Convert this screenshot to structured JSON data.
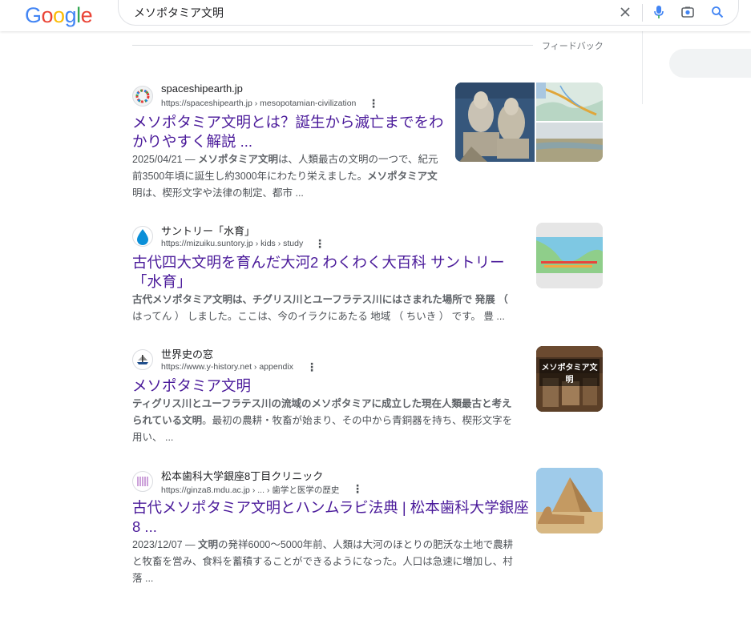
{
  "header": {
    "logo": "Google",
    "query": "メソポタミア文明"
  },
  "feedback_label": "フィードバック",
  "results": [
    {
      "site_name": "spaceshipearth.jp",
      "url": "https://spaceshipearth.jp",
      "path": " › mesopotamian-civilization",
      "title_line1": "メソポタミア文明とは？誕生から滅亡までをわ",
      "title_line2": "かりやすく解説 ...",
      "date": "2025/04/21 —",
      "snippet_line1_b": "メソポタミア文明",
      "snippet_line1_rest": "は、人類最古の文明の一つで、紀元",
      "snippet_line2_a": "前3500年頃に誕生し約3000年にわたり栄えました。",
      "snippet_line2_b": "メソポタミア文",
      "snippet_line3_b": "明",
      "snippet_line3_rest": "は、楔形文字や法律の制定、都市 ..."
    },
    {
      "site_name": "サントリー「水育」",
      "url": "https://mizuiku.suntory.jp",
      "path": " › kids › study",
      "title_line1": "古代四大文明を育んだ大河2 わくわく大百科 サントリー",
      "title_line2": "「水育」",
      "snippet_line1_b": "古代メソポタミア文明は、チグリス川とユーフラテス川にはさまれた場所で 発展 （",
      "snippet_line2": "はってん ） しました。ここは、今のイラクにあたる 地域 （ ちいき ） です。 豊 ..."
    },
    {
      "site_name": "世界史の窓",
      "url": "https://www.y-history.net",
      "path": " › appendix",
      "title_line1": "メソポタミア文明",
      "snippet_line1_b": "ティグリス川とユーフラテス川の流域のメソポタミアに成立した現在人類最古と考え",
      "snippet_line2_b": "られている文明",
      "snippet_line2_rest": "。最初の農耕・牧畜が始まり、その中から青銅器を持ち、楔形文字を",
      "snippet_line3": "用い、 ...",
      "thumb_text": "メソポタミア文明"
    },
    {
      "site_name": "松本歯科大学銀座8丁目クリニック",
      "url": "https://ginza8.mdu.ac.jp",
      "path": " › ... › 歯学と医学の歴史",
      "title_line1": "古代メソポタミア文明とハンムラビ法典 | 松本歯科大学銀座",
      "title_line2": "8 ...",
      "date": "2023/12/07 —",
      "snippet_line1_b": "文明",
      "snippet_line1_rest": "の発祥6000～5000年前、人類は大河のほとりの肥沃な土地で農耕",
      "snippet_line2": "と牧畜を営み、食料を蓄積することができるようになった。人口は急速に増加し、村",
      "snippet_line3": "落 ..."
    }
  ]
}
